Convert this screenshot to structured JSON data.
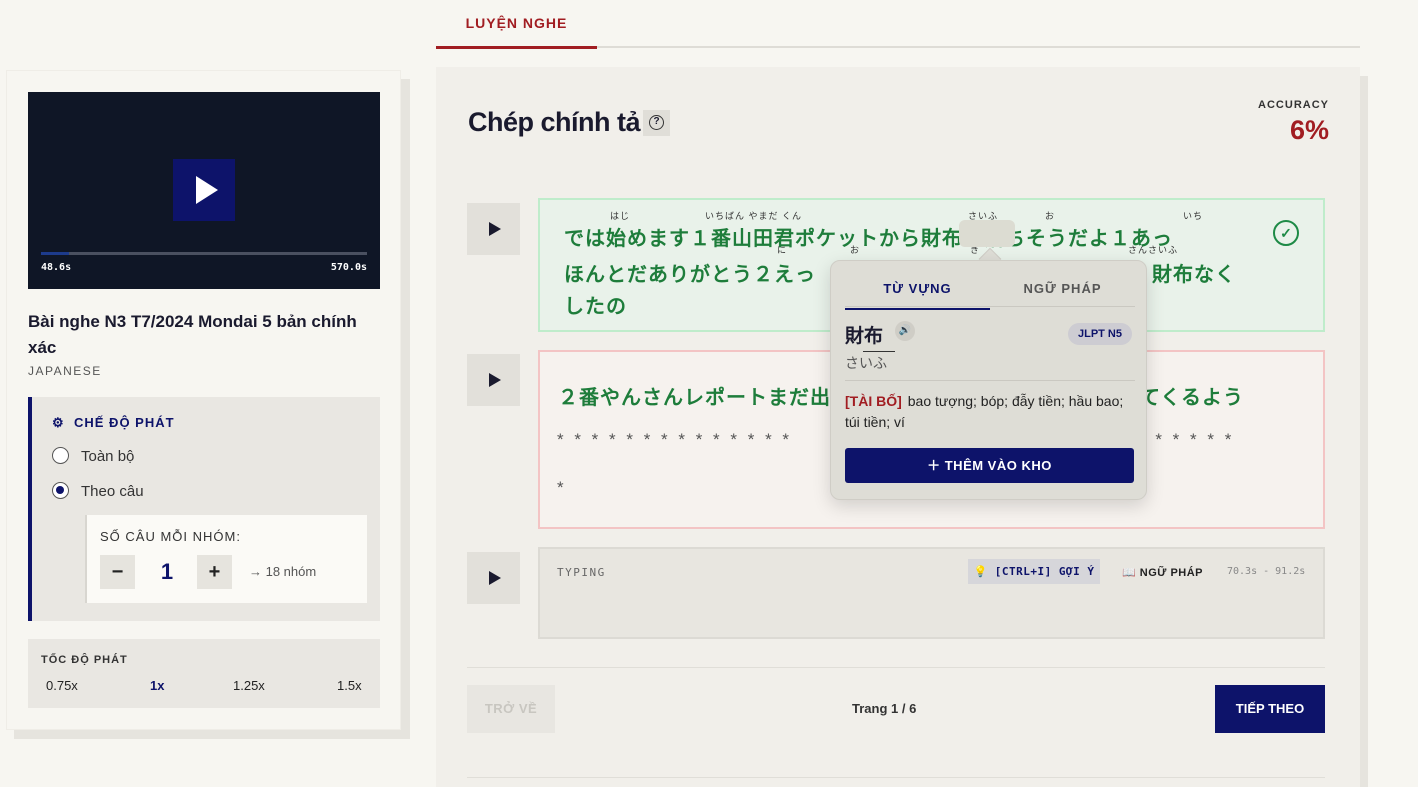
{
  "tabs": {
    "active": "LUYỆN NGHE"
  },
  "video": {
    "current": "48.6s",
    "total": "570.0s",
    "progress": 0.085
  },
  "lesson": {
    "title": "Bài nghe N3 T7/2024 Mondai 5 bản chính xác",
    "language": "JAPANESE"
  },
  "mode": {
    "heading": "CHẾ ĐỘ PHÁT",
    "options": [
      "Toàn bộ",
      "Theo câu"
    ],
    "selected": "Theo câu",
    "group_label": "SỐ CÂU MỖI NHÓM:",
    "minus": "−",
    "plus": "+",
    "value": "1",
    "groups": "→ 18 nhóm"
  },
  "speed": {
    "label": "TỐC ĐỘ PHÁT",
    "options": [
      "0.75x",
      "1x",
      "1.25x",
      "1.5x"
    ],
    "active": "1x"
  },
  "main": {
    "title": "Chép chính tả",
    "help": "?",
    "accuracy_label": "ACCURACY",
    "accuracy": "6%"
  },
  "sentences": [
    {
      "lines": [
        "では始めます１番山田君ポケットから財布が落ちそうだよ１あっ",
        "ほんとだありがとう２えっ",
        "したの"
      ],
      "line2_tail": "財布なく",
      "furigana": [
        "はじ",
        "いちばん やまだ くん",
        "さいふ",
        "お",
        "いち",
        "に",
        "お",
        "き",
        "さんさいふ"
      ],
      "correct": true,
      "check": "✓"
    },
    {
      "line": "２番やんさんレポートまだ出",
      "line_tail": "てくるよう",
      "stars_1a": "* * * * * * * * * * * * * *",
      "stars_1b": "* * * * * *",
      "stars_2": "*"
    }
  ],
  "typing": {
    "label": "TYPING",
    "hint": "[CTRL+I] GỢI Ý",
    "grammar": "NGỮ PHÁP",
    "range": "70.3s - 91.2s"
  },
  "nav": {
    "back": "TRỞ VỀ",
    "page": "Trang 1 / 6",
    "next": "TIẾP THEO"
  },
  "popup": {
    "tab_vocab": "TỪ VỰNG",
    "tab_grammar": "NGỮ PHÁP",
    "word": "財布",
    "reading": "さいふ",
    "level": "JLPT N5",
    "hanviet": "[TÀI BỐ]",
    "meaning": "bao tượng; bóp; đẫy tiền; hầu bao; túi tiền; ví",
    "add": "＋ THÊM VÀO KHO",
    "speaker": "🔊"
  },
  "colors": {
    "primary": "#0d136a",
    "accent": "#a11d22",
    "correct": "#1e7d3b"
  }
}
